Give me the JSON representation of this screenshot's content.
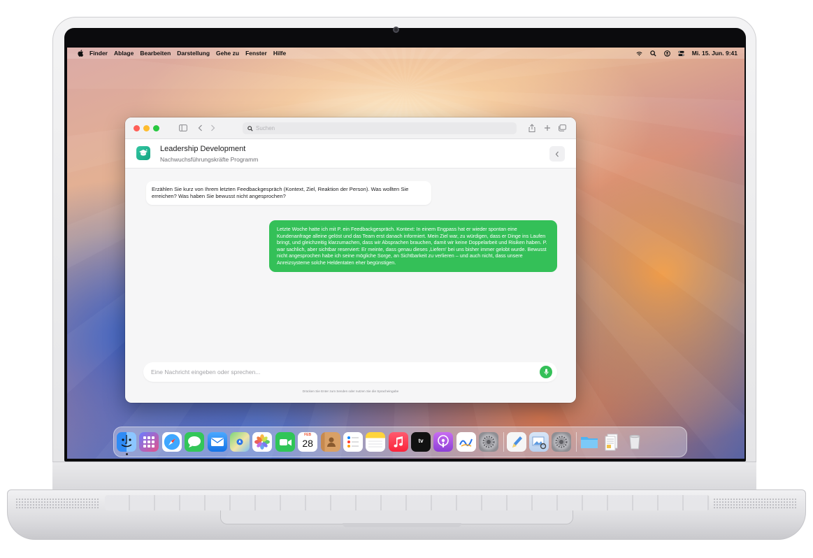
{
  "menubar": {
    "items": [
      "Finder",
      "Ablage",
      "Bearbeiten",
      "Darstellung",
      "Gehe zu",
      "Fenster",
      "Hilfe"
    ],
    "clock": "Mi. 15. Jun. 9:41"
  },
  "browser": {
    "search_placeholder": "Suchen"
  },
  "app": {
    "title": "Leadership Development",
    "subtitle": "Nachwuchsführungskräfte Programm",
    "brand_color": "#1fb48f"
  },
  "chat": {
    "messages": [
      {
        "role": "assistant",
        "text": "Erzählen Sie kurz von Ihrem letzten Feedbackgespräch (Kontext, Ziel, Reaktion der Person). Was wollten Sie erreichen? Was haben Sie bewusst nicht angesprochen?"
      },
      {
        "role": "user",
        "text": "Letzte Woche hatte ich mit P. ein Feedbackgespräch. Kontext: In einem Engpass hat er wieder spontan eine Kundenanfrage alleine gelöst und das Team erst danach informiert. Mein Ziel war, zu würdigen, dass er Dinge ins Laufen bringt, und gleichzeitig klarzumachen, dass wir Absprachen brauchen, damit wir keine Doppelarbeit und Risiken haben. P. war sachlich, aber sichtbar reserviert: Er meinte, dass genau dieses ‚Liefern' bei uns bisher immer gelobt wurde. Bewusst nicht angesprochen habe ich seine mögliche Sorge, an Sichtbarkeit zu verlieren – und auch nicht, dass unsere Anreizsysteme solche Heldentaten eher begünstigen."
      }
    ],
    "composer_placeholder": "Eine Nachricht eingeben oder sprechen...",
    "hint": "Drücken Sie Enter zum Senden oder nutzen Sie die Spracheingabe",
    "user_bubble_color": "#34c058"
  },
  "dock": {
    "calendar_month": "FEB",
    "calendar_day": "28",
    "tv_label": "tv",
    "apps": [
      "finder",
      "launchpad",
      "safari",
      "messages",
      "mail",
      "maps",
      "photos",
      "facetime",
      "calendar",
      "contacts",
      "reminders",
      "notes",
      "music",
      "tv",
      "podcasts",
      "freeform",
      "system-settings",
      "textedit",
      "preview",
      "system-settings-2",
      "folder",
      "documents",
      "trash"
    ]
  }
}
